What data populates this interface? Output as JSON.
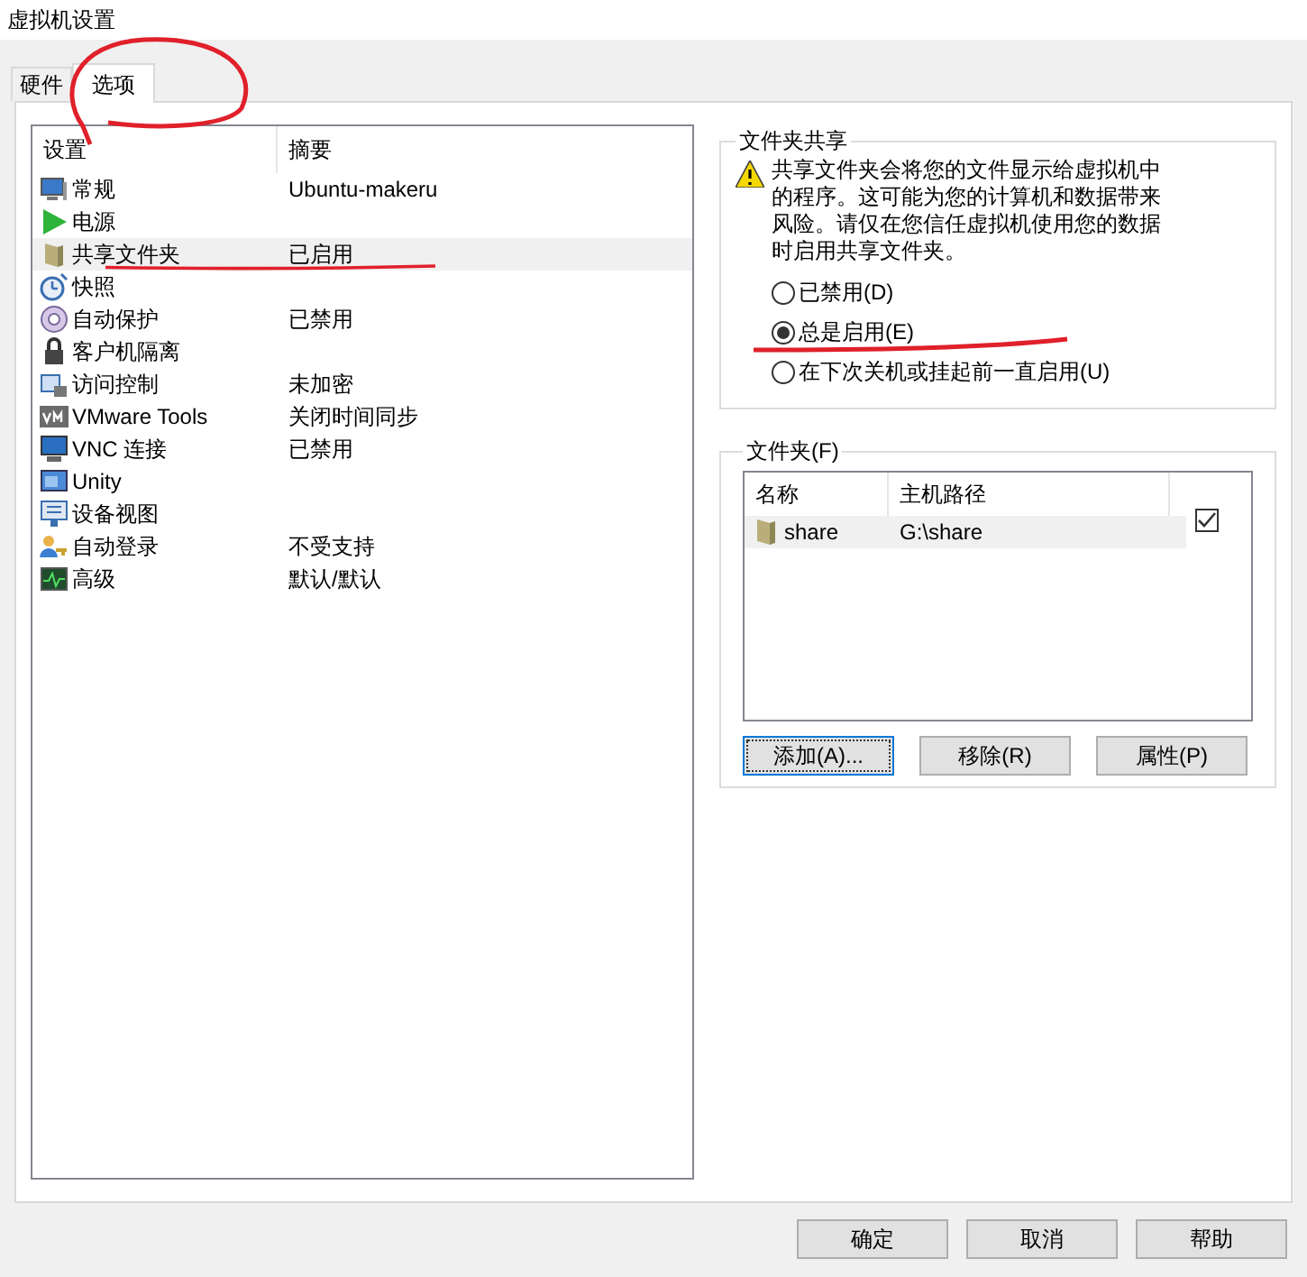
{
  "window": {
    "title": "虚拟机设置"
  },
  "tabs": [
    {
      "label": "硬件",
      "selected": false
    },
    {
      "label": "选项",
      "selected": true
    }
  ],
  "settings": {
    "columns": [
      "设置",
      "摘要"
    ],
    "items": [
      {
        "name": "常规",
        "summary": "Ubuntu-makeru",
        "selected": false
      },
      {
        "name": "电源",
        "selected": false
      },
      {
        "name": "共享文件夹",
        "summary": "已启用",
        "selected": true
      },
      {
        "name": "快照",
        "selected": false
      },
      {
        "name": "自动保护",
        "summary": "已禁用",
        "selected": false
      },
      {
        "name": "客户机隔离",
        "selected": false
      },
      {
        "name": "访问控制",
        "summary": "未加密",
        "selected": false
      },
      {
        "name": "VMware Tools",
        "summary": "关闭时间同步",
        "selected": false
      },
      {
        "name": "VNC 连接",
        "summary": "已禁用",
        "selected": false
      },
      {
        "name": "Unity",
        "selected": false
      },
      {
        "name": "设备视图",
        "selected": false
      },
      {
        "name": "自动登录",
        "summary": "不受支持",
        "selected": false
      },
      {
        "name": "高级",
        "summary": "默认/默认",
        "selected": false
      }
    ]
  },
  "sharing": {
    "title": "文件夹共享",
    "warning": "共享文件夹会将您的文件显示给虚拟机中的程序。这可能为您的计算机和数据带来风险。请仅在您信任虚拟机使用您的数据时启用共享文件夹。",
    "options": [
      {
        "label": "已禁用(D)",
        "selected": false
      },
      {
        "label": "总是启用(E)",
        "selected": true
      },
      {
        "label": "在下次关机或挂起前一直启用(U)",
        "selected": false
      }
    ]
  },
  "folders": {
    "title": "文件夹(F)",
    "columns": [
      "名称",
      "主机路径"
    ],
    "rows": [
      {
        "name": "share",
        "path": "G:\\share",
        "checked": true
      }
    ],
    "buttons": [
      "添加(A)...",
      "移除(R)",
      "属性(P)"
    ]
  },
  "buttons": [
    "确定",
    "取消",
    "帮助"
  ]
}
